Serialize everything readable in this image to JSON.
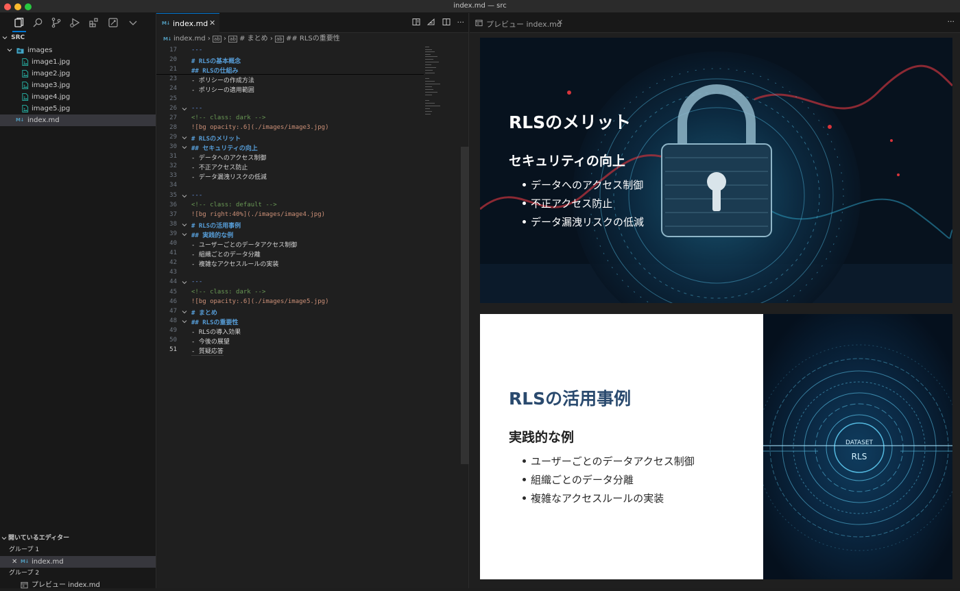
{
  "window": {
    "title": "index.md — src"
  },
  "explorer": {
    "section": "SRC",
    "folder": "images",
    "files": [
      "image1.jpg",
      "image2.jpg",
      "image3.jpg",
      "image4.jpg",
      "image5.jpg"
    ],
    "active_file": "index.md"
  },
  "open_editors": {
    "header": "開いているエディター",
    "group1": "グループ 1",
    "group1_item": "index.md",
    "group2": "グループ 2",
    "group2_item": "プレビュー index.md"
  },
  "editor": {
    "tab_label": "index.md",
    "breadcrumb": {
      "file": "index.md",
      "h1": "# まとめ",
      "h2": "## RLSの重要性"
    },
    "lines": [
      {
        "n": "17",
        "t": "---"
      },
      {
        "n": "20",
        "t": "# RLSの基本概念"
      },
      {
        "n": "21",
        "t": "## RLSの仕組み"
      },
      {
        "n": "23",
        "t": "- ポリシーの作成方法"
      },
      {
        "n": "24",
        "t": "- ポリシーの適用範囲"
      },
      {
        "n": "25",
        "t": ""
      },
      {
        "n": "26",
        "t": "---"
      },
      {
        "n": "27",
        "t": "<!-- class: dark -->"
      },
      {
        "n": "28",
        "t": "![bg opacity:.6](./images/image3.jpg)"
      },
      {
        "n": "29",
        "t": "# RLSのメリット"
      },
      {
        "n": "30",
        "t": "## セキュリティの向上"
      },
      {
        "n": "31",
        "t": "- データへのアクセス制御"
      },
      {
        "n": "32",
        "t": "- 不正アクセス防止"
      },
      {
        "n": "33",
        "t": "- データ漏洩リスクの低減"
      },
      {
        "n": "34",
        "t": ""
      },
      {
        "n": "35",
        "t": "---"
      },
      {
        "n": "36",
        "t": "<!-- class: default -->"
      },
      {
        "n": "37",
        "t": "![bg right:40%](./images/image4.jpg)"
      },
      {
        "n": "38",
        "t": "# RLSの活用事例"
      },
      {
        "n": "39",
        "t": "## 実践的な例"
      },
      {
        "n": "40",
        "t": "- ユーザーごとのデータアクセス制御"
      },
      {
        "n": "41",
        "t": "- 組織ごとのデータ分離"
      },
      {
        "n": "42",
        "t": "- 複雑なアクセスルールの実装"
      },
      {
        "n": "43",
        "t": ""
      },
      {
        "n": "44",
        "t": "---"
      },
      {
        "n": "45",
        "t": "<!-- class: dark -->"
      },
      {
        "n": "46",
        "t": "![bg opacity:.6](./images/image5.jpg)"
      },
      {
        "n": "47",
        "t": "# まとめ"
      },
      {
        "n": "48",
        "t": "## RLSの重要性"
      },
      {
        "n": "49",
        "t": "- RLSの導入効果"
      },
      {
        "n": "50",
        "t": "- 今後の展望"
      },
      {
        "n": "51",
        "t": "- 質疑応答"
      }
    ]
  },
  "preview": {
    "tab_label": "プレビュー index.md",
    "slide1": {
      "title": "RLSのメリット",
      "subtitle": "セキュリティの向上",
      "bullets": [
        "データへのアクセス制御",
        "不正アクセス防止",
        "データ漏洩リスクの低減"
      ]
    },
    "slide2": {
      "title": "RLSの活用事例",
      "subtitle": "実践的な例",
      "bullets": [
        "ユーザーごとのデータアクセス制御",
        "組織ごとのデータ分離",
        "複雑なアクセスルールの実装"
      ],
      "image_text_1": "DATASET",
      "image_text_2": "RLS"
    }
  },
  "colors": {
    "accent": "#0078d4",
    "slide2_title": "#2a4a6e",
    "md_icon": "#519aba"
  }
}
